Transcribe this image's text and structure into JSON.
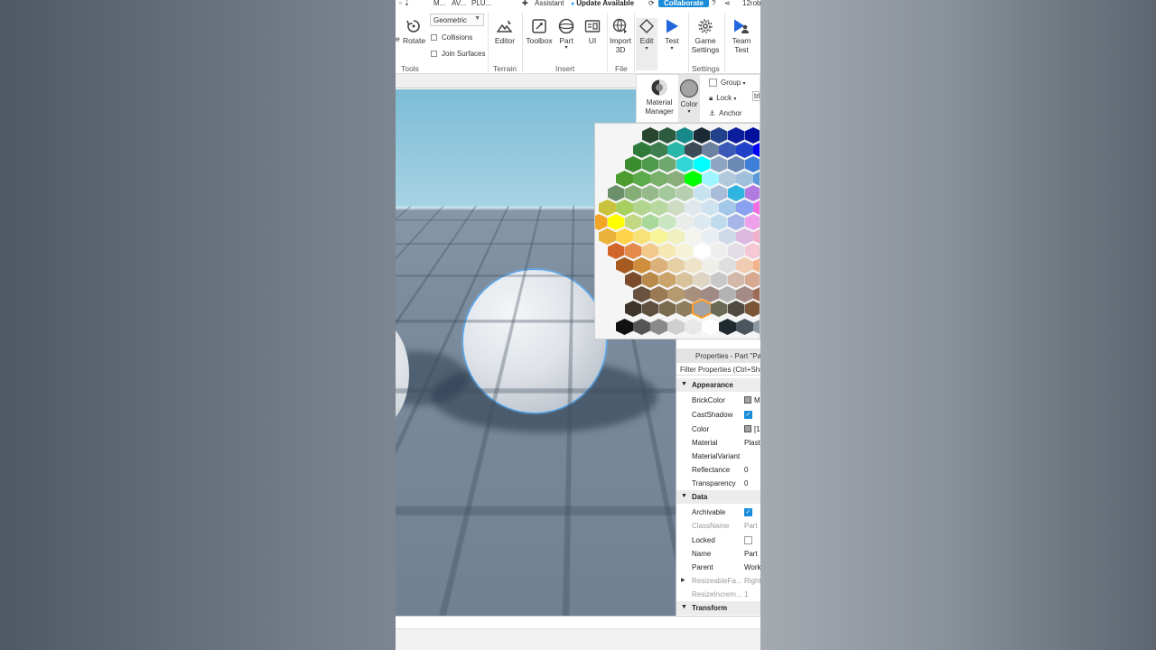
{
  "topbar": {
    "tabs": [
      "M...",
      "AV...",
      "PLU...",
      "Assistant"
    ],
    "update": "Update Available",
    "collaborate": "Collaborate",
    "user": "12rob"
  },
  "ribbon": {
    "scale_label": "e",
    "rotate": "Rotate",
    "geometric": "Geometric",
    "collisions": "Collisions",
    "join_surfaces": "Join Surfaces",
    "tools_group": "Tools",
    "editor": "Editor",
    "terrain_group": "Terrain",
    "toolbox": "Toolbox",
    "part": "Part",
    "ui": "UI",
    "insert_group": "Insert",
    "import3d_line1": "Import",
    "import3d_line2": "3D",
    "file_group": "File",
    "edit": "Edit",
    "test": "Test",
    "game_settings_line1": "Game",
    "game_settings_line2": "Settings",
    "settings_group": "Settings",
    "team_test_line1": "Team",
    "team_test_line2": "Test"
  },
  "model_panel": {
    "material_manager_line1": "Material",
    "material_manager_line2": "Manager",
    "color": "Color",
    "group": "Group",
    "lock": "Lock",
    "anchor": "Anchor",
    "ctrl_hint": "trl"
  },
  "properties": {
    "title": "Properties - Part \"Par",
    "filter": "Filter Properties (Ctrl+Shift",
    "appearance": "Appearance",
    "brickcolor": "BrickColor",
    "brickcolor_value": "M",
    "castshadow": "CastShadow",
    "color": "Color",
    "color_value": "[1",
    "material": "Material",
    "material_value": "Plasti",
    "materialvariant": "MaterialVariant",
    "reflectance": "Reflectance",
    "reflectance_value": "0",
    "transparency": "Transparency",
    "transparency_value": "0",
    "data": "Data",
    "archivable": "Archivable",
    "classname": "ClassName",
    "classname_value": "Part",
    "locked": "Locked",
    "name": "Name",
    "name_value": "Part",
    "parent": "Parent",
    "parent_value": "Work",
    "resizeablefaces": "ResizeableFa...",
    "resizeablefaces_value": "Right",
    "resizeincrement": "ResizeIncrem...",
    "resizeincrement_value": "1",
    "transform": "Transform"
  },
  "colors": {
    "accent": "#1a8bd8",
    "selection": "#4aa8ff"
  }
}
